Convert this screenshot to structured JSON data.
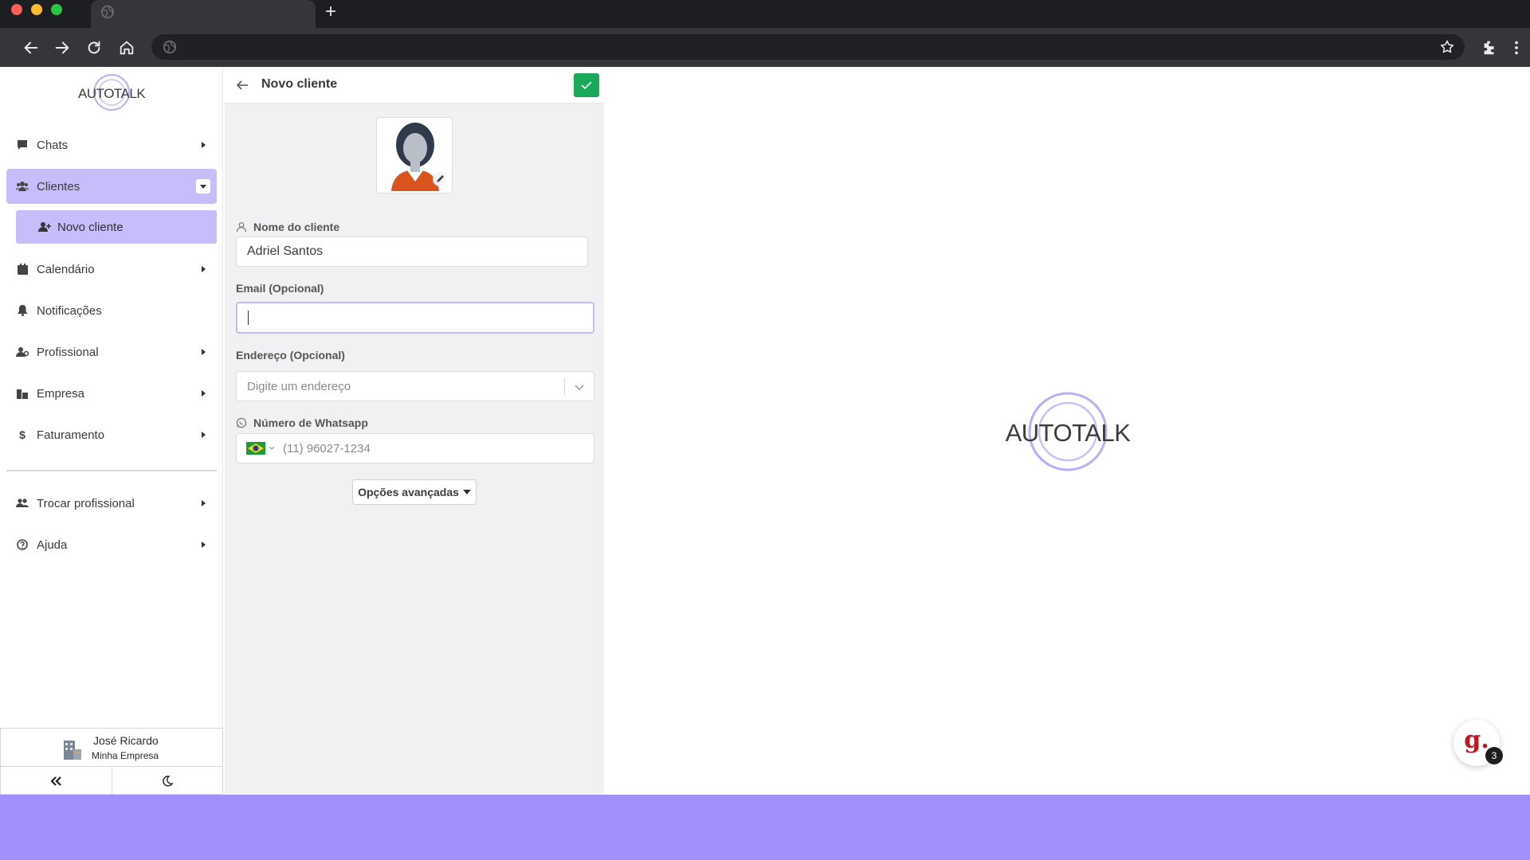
{
  "browser": {
    "new_tab_symbol": "+"
  },
  "app": {
    "logo_text": "AUTOTALK",
    "brand_color": "#c6befa",
    "accent_green": "#1aa95b"
  },
  "sidebar": {
    "items": [
      {
        "label": "Chats",
        "icon": "chat-icon"
      },
      {
        "label": "Clientes",
        "icon": "users-icon"
      },
      {
        "label": "Novo cliente",
        "icon": "user-plus-icon"
      },
      {
        "label": "Calendário",
        "icon": "calendar-icon"
      },
      {
        "label": "Notificações",
        "icon": "bell-icon"
      },
      {
        "label": "Profissional",
        "icon": "user-tie-icon"
      },
      {
        "label": "Empresa",
        "icon": "building-icon"
      },
      {
        "label": "Faturamento",
        "icon": "dollar-icon"
      },
      {
        "label": "Trocar profissional",
        "icon": "users-switch-icon"
      },
      {
        "label": "Ajuda",
        "icon": "help-icon"
      }
    ],
    "user": {
      "name": "José Ricardo",
      "company": "Minha Empresa"
    }
  },
  "form": {
    "title": "Novo cliente",
    "name_label": "Nome do cliente",
    "name_value": "Adriel Santos",
    "email_label": "Email (Opcional)",
    "email_value": "",
    "address_label": "Endereço (Opcional)",
    "address_placeholder": "Digite um endereço",
    "whatsapp_label": "Número de Whatsapp",
    "whatsapp_placeholder": "(11) 96027-1234",
    "advanced_label": "Opções avançadas"
  },
  "chat_widget": {
    "letter": "g.",
    "badge": "3"
  }
}
